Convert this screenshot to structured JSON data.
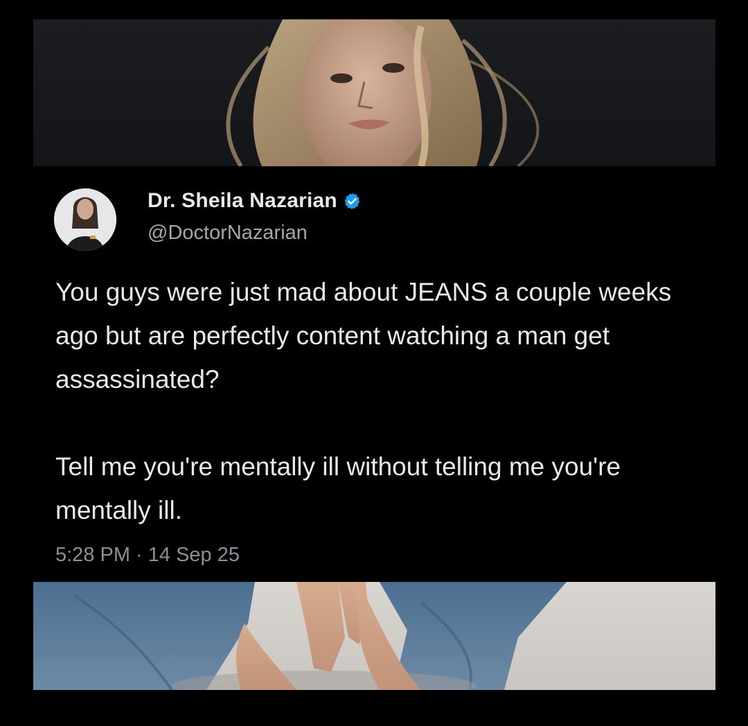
{
  "tweet": {
    "author": {
      "display_name": "Dr. Sheila Nazarian",
      "handle": "@DoctorNazarian",
      "verified": true,
      "verified_icon": "verified-badge-icon"
    },
    "text": {
      "paragraph_1": "You guys were just mad about JEANS a couple weeks ago but are perfectly content watching a man get assassinated?",
      "paragraph_2": "Tell me you're mentally ill without telling me you're mentally ill."
    },
    "timestamp": "5:28 PM · 14 Sep 25"
  },
  "colors": {
    "background": "#000000",
    "text_primary": "#e7e9ea",
    "text_secondary": "#8b9096",
    "verified_blue": "#1d9bf0",
    "denim": "#4e6f8f"
  },
  "images": {
    "top_photo": "portrait-photo",
    "bottom_photo": "jeans-photo"
  }
}
